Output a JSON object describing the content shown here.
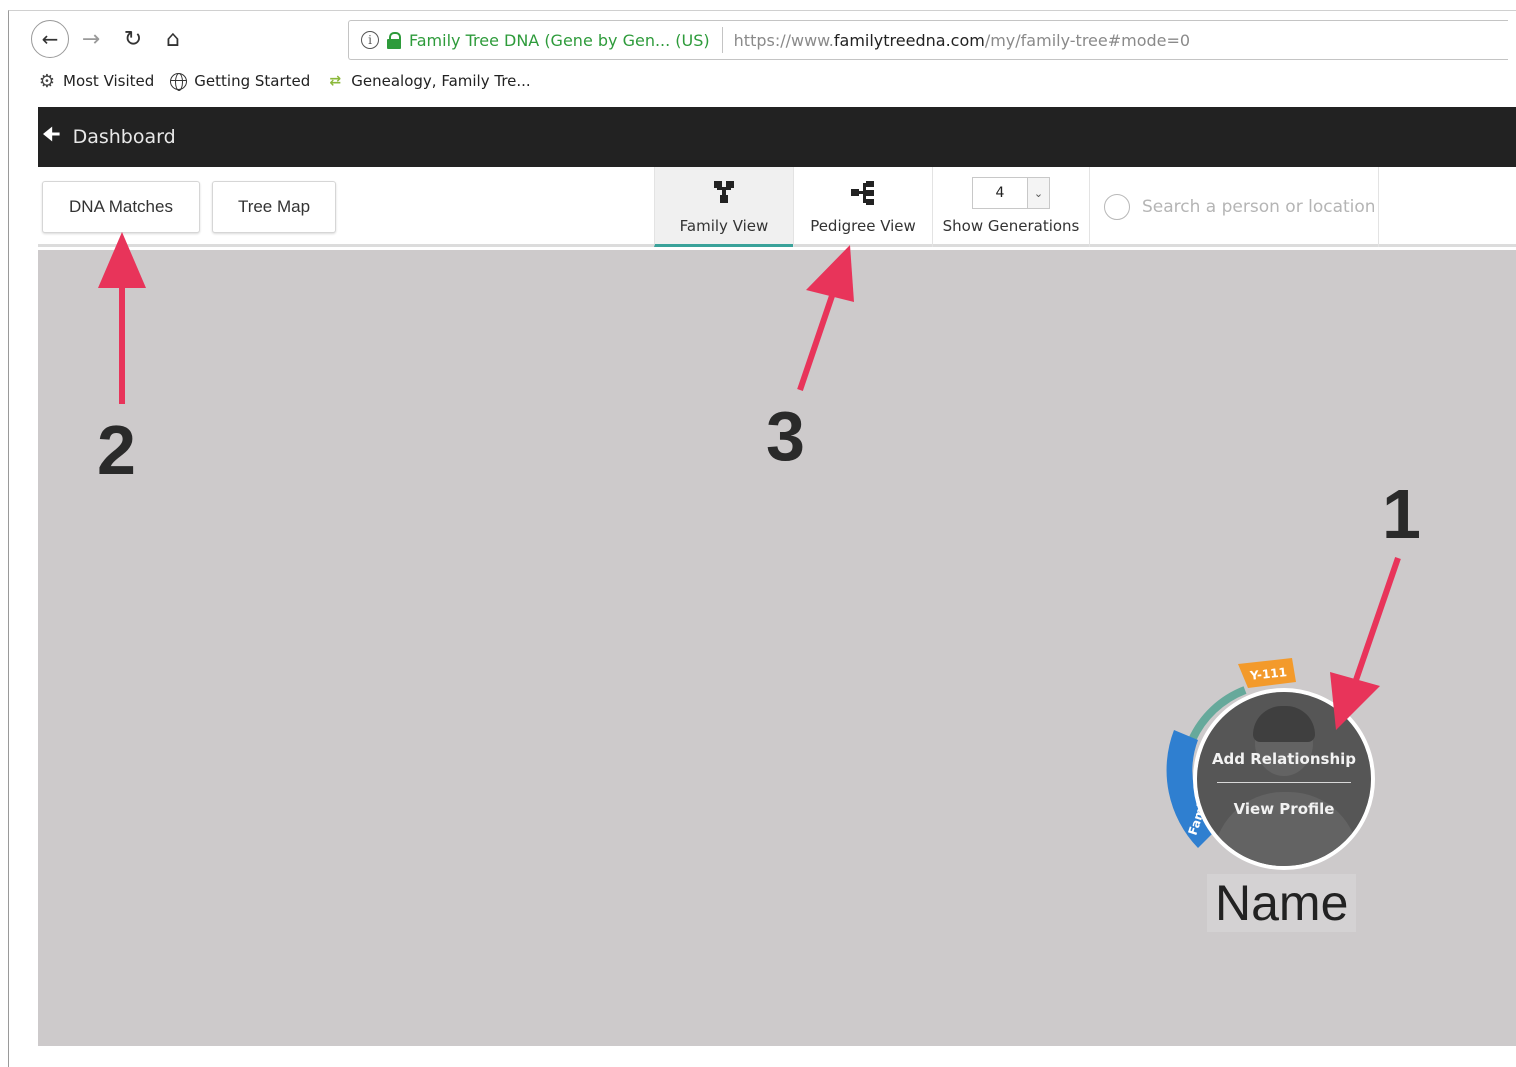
{
  "browser": {
    "site_identity": "Family Tree DNA (Gene by Gen... (US)",
    "url_prefix": "https://www.",
    "url_host": "familytreedna.com",
    "url_path": "/my/family-tree#mode=0",
    "bookmarks": [
      {
        "label": "Most Visited",
        "icon": "gear-icon"
      },
      {
        "label": "Getting Started",
        "icon": "globe-icon"
      },
      {
        "label": "Genealogy, Family Tre...",
        "icon": "dna-icon"
      }
    ]
  },
  "header": {
    "back_label": "Dashboard"
  },
  "toolbar": {
    "dna_matches_label": "DNA Matches",
    "tree_map_label": "Tree Map",
    "family_view_label": "Family View",
    "pedigree_view_label": "Pedigree View",
    "generations_value": "4",
    "generations_label": "Show Generations",
    "search_placeholder": "Search a person or location",
    "active_tab": "Family View",
    "accent_color": "#3aa29a"
  },
  "node": {
    "add_relationship_label": "Add Relationship",
    "view_profile_label": "View Profile",
    "name": "Name",
    "badge_ydna": "Y-111",
    "badge_family_finder": "Family Finder",
    "badge_colors": {
      "ydna": "#f39a2b",
      "family_finder": "#2f7fd0",
      "mtdna": "#66a99b"
    }
  },
  "annotations": {
    "one": "1",
    "two": "2",
    "three": "3",
    "arrow_color": "#e8345a"
  }
}
